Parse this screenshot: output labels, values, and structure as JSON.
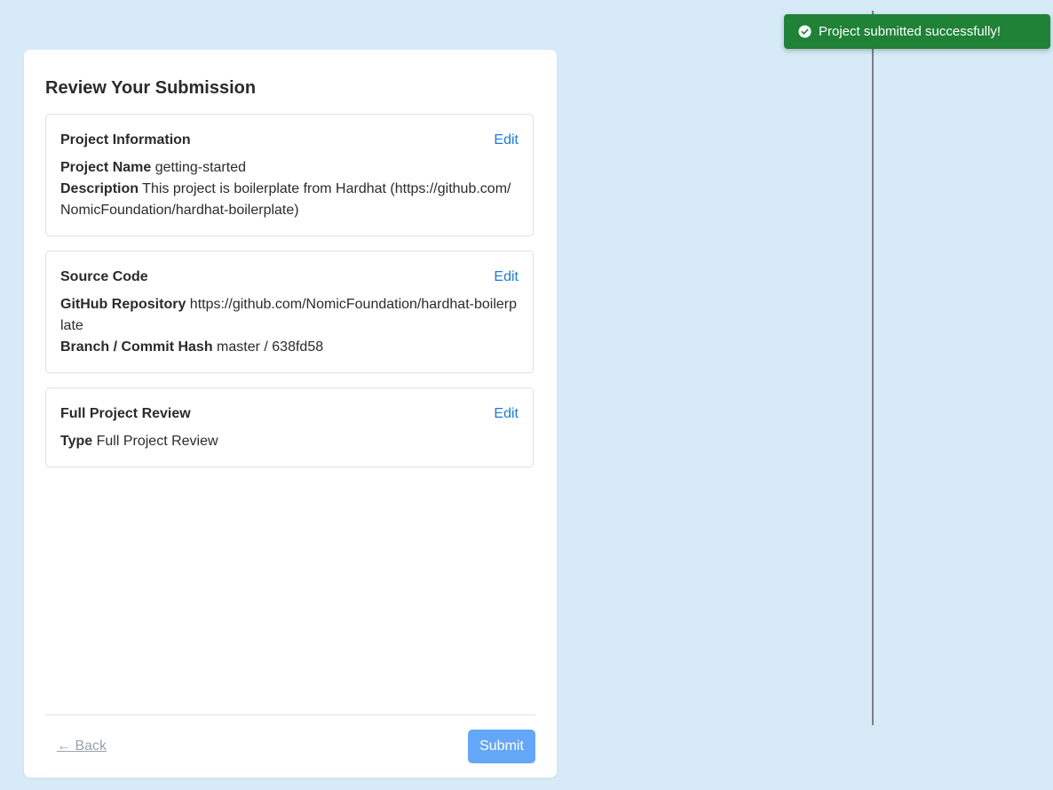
{
  "panel": {
    "title": "Review Your Submission"
  },
  "sections": [
    {
      "title": "Project Information",
      "edit_label": "Edit",
      "fields": [
        {
          "label": "Project Name",
          "value": "getting-started"
        },
        {
          "label": "Description",
          "value": "This project is boilerplate from Hardhat (https://github.com/NomicFoundation/hardhat-boilerplate)"
        }
      ]
    },
    {
      "title": "Source Code",
      "edit_label": "Edit",
      "fields": [
        {
          "label": "GitHub Repository",
          "value": "https://github.com/NomicFoundation/hardhat-boilerplate"
        },
        {
          "label": "Branch / Commit Hash",
          "value": "master / 638fd58"
        }
      ]
    },
    {
      "title": "Full Project Review",
      "edit_label": "Edit",
      "fields": [
        {
          "label": "Type",
          "value": "Full Project Review"
        }
      ]
    }
  ],
  "footer": {
    "back_label": "← Back",
    "submit_label": "Submit"
  },
  "toast": {
    "message": "Project submitted successfully!",
    "icon": "check-circle-icon",
    "color": "#1f8237"
  },
  "colors": {
    "background": "#d6ebf7",
    "link": "#1f7ad6",
    "submit_button": "#64a6f7"
  }
}
